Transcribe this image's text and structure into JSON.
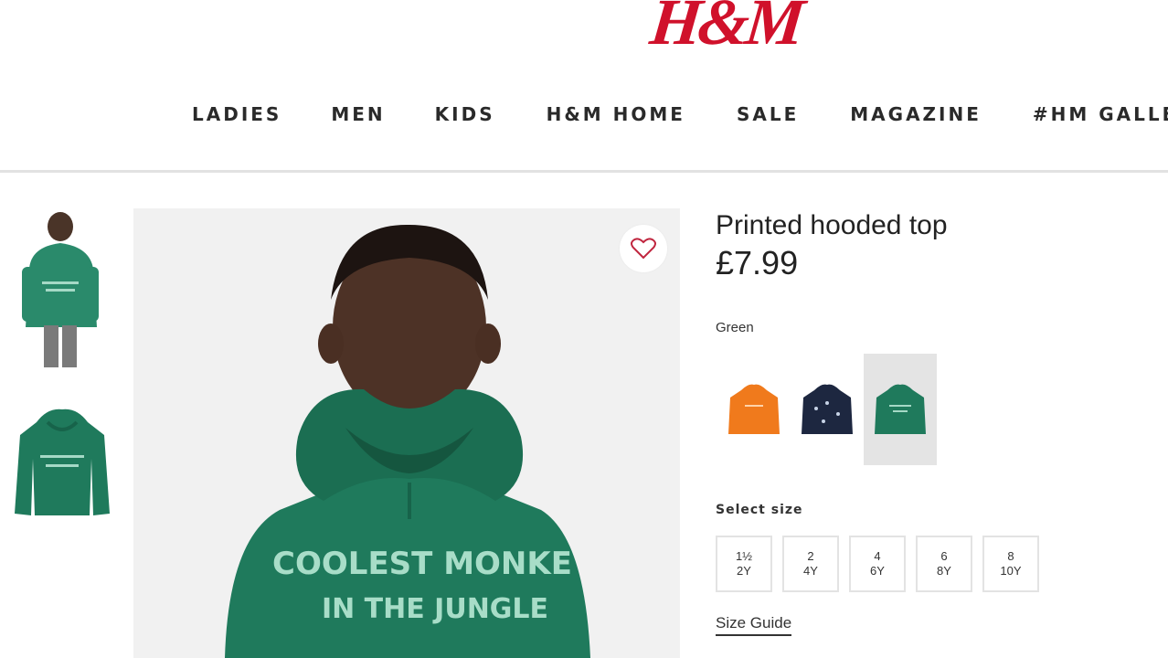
{
  "header": {
    "logo_text": "H&M",
    "brand_color": "#d0112b",
    "nav": [
      {
        "label": "LADIES"
      },
      {
        "label": "MEN"
      },
      {
        "label": "KIDS"
      },
      {
        "label": "H&M HOME"
      },
      {
        "label": "SALE"
      },
      {
        "label": "MAGAZINE"
      },
      {
        "label": "#HM GALLE"
      }
    ]
  },
  "gallery": {
    "hoodie_color": "#1f7a5c",
    "hoodie_print": [
      "COOLEST MONKE",
      "IN THE JUNGLE"
    ],
    "favourite_icon": "heart-icon"
  },
  "product": {
    "title": "Printed hooded top",
    "price": "£7.99",
    "color_label": "Green",
    "swatches": [
      {
        "name": "orange",
        "color": "#f07a1c"
      },
      {
        "name": "navy",
        "color": "#1d2740"
      },
      {
        "name": "green",
        "color": "#1f7a5c",
        "selected": true
      }
    ],
    "size_label": "Select size",
    "sizes": [
      {
        "line1": "1½",
        "line2": "2Y"
      },
      {
        "line1": "2",
        "line2": "4Y"
      },
      {
        "line1": "4",
        "line2": "6Y"
      },
      {
        "line1": "6",
        "line2": "8Y"
      },
      {
        "line1": "8",
        "line2": "10Y"
      }
    ],
    "size_guide": "Size Guide"
  }
}
